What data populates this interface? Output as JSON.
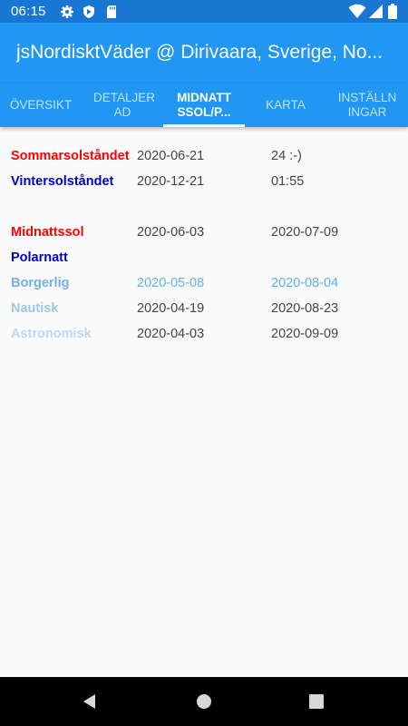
{
  "status": {
    "time": "06:15"
  },
  "app": {
    "title": "jsNordisktVäder @ Dirivaara, Sverige, No..."
  },
  "tabs": [
    {
      "label": "ÖVERSIKT"
    },
    {
      "label": "DETALJER AD"
    },
    {
      "label": "MIDNATT SSOL/P..."
    },
    {
      "label": "KARTA"
    },
    {
      "label": "INSTÄLLN INGAR"
    }
  ],
  "solstice": [
    {
      "name": "Sommarsolståndet",
      "col1": "2020-06-21",
      "col2": "24 :-)",
      "color": "#ff0000"
    },
    {
      "name": "Vintersolståndet",
      "col1": "2020-12-21",
      "col2": "01:55",
      "color": "#0000cc"
    }
  ],
  "periods": [
    {
      "name": "Midnattssol",
      "col1": "2020-06-03",
      "col2": "2020-07-09",
      "color": "#ff0000",
      "dateColor": "#444444"
    },
    {
      "name": "Polarnatt",
      "col1": "",
      "col2": "",
      "color": "#0000cc",
      "dateColor": "#444444"
    },
    {
      "name": "Borgerlig",
      "col1": "2020-05-08",
      "col2": "2020-08-04",
      "color": "#6fb0e8",
      "dateColor": "#5ab4f0"
    },
    {
      "name": "Nautisk",
      "col1": "2020-04-19",
      "col2": "2020-08-23",
      "color": "#9ec5ea",
      "dateColor": "#444444"
    },
    {
      "name": "Astronomisk",
      "col1": "2020-04-03",
      "col2": "2020-09-09",
      "color": "#bcd8f2",
      "dateColor": "#444444"
    }
  ],
  "icons": [
    "settings-gear-icon",
    "shield-icon",
    "sd-card-icon",
    "wifi-icon",
    "signal-icon",
    "battery-icon",
    "back-icon",
    "home-icon",
    "recents-icon"
  ],
  "colors": {
    "primary": "#2196f3",
    "primaryDark": "#1976d2",
    "background": "#fafafa"
  }
}
